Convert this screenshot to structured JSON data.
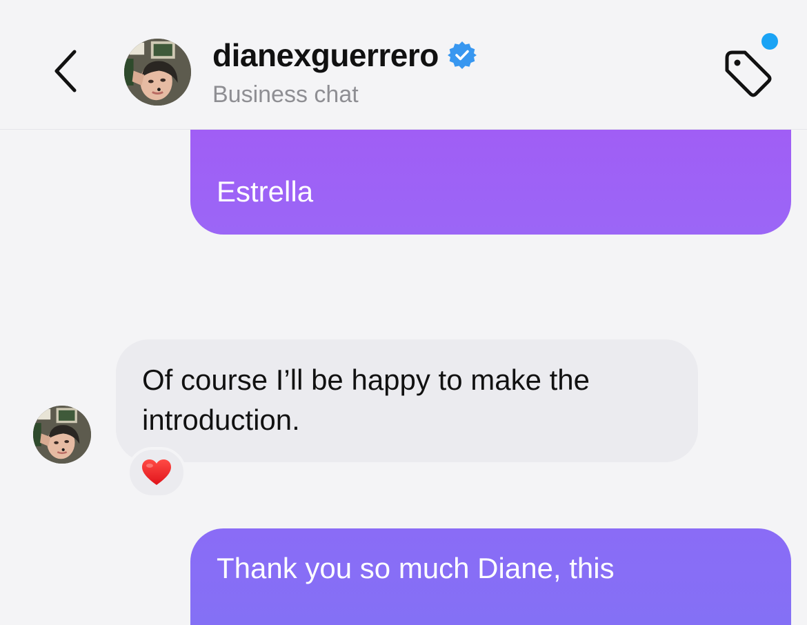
{
  "header": {
    "username": "dianexguerrero",
    "subtitle": "Business chat",
    "verified": true,
    "back_icon": "chevron-left-icon",
    "tag_icon": "tag-icon",
    "notification_dot_color": "#1aa3f5"
  },
  "messages": [
    {
      "direction": "outgoing",
      "text": "Estrella"
    },
    {
      "direction": "incoming",
      "text": "Of course I’ll be happy to make the introduction.",
      "reaction": "heart-icon"
    },
    {
      "direction": "outgoing",
      "text": "Thank you so much Diane, this"
    }
  ],
  "colors": {
    "outgoing_bubble": "#9d63f6",
    "incoming_bubble": "#ebebef",
    "background": "#f4f4f6",
    "verified_badge": "#3897f0"
  }
}
